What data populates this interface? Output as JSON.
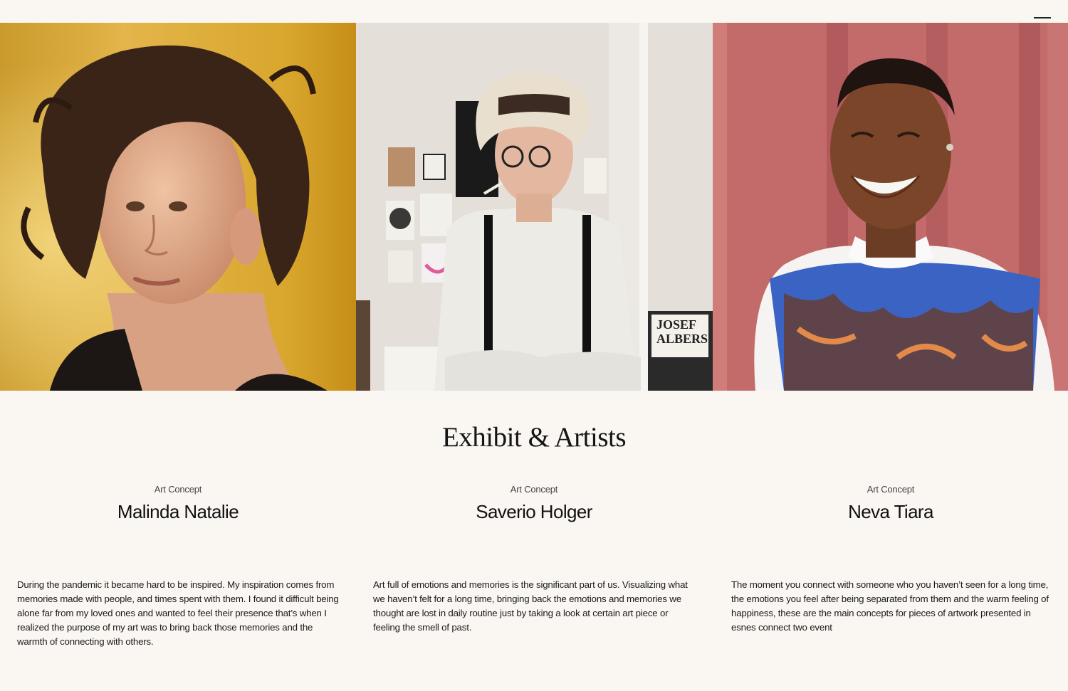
{
  "header": {
    "menu_icon": "hamburger-menu-icon"
  },
  "gallery": {
    "photos": [
      {
        "subject": "portrait-woman-curly-hair",
        "background": "#d9a72e"
      },
      {
        "subject": "portrait-man-hat-glasses",
        "background": "#dedad3"
      },
      {
        "subject": "portrait-woman-smiling",
        "background": "#c36b6b"
      }
    ]
  },
  "section": {
    "title": "Exhibit & Artists"
  },
  "artists": [
    {
      "category": "Art Concept",
      "name": "Malinda Natalie",
      "bio": "During the pandemic it became hard to be inspired. My inspiration comes from memories made with people, and times spent with them. I found it difficult being alone far from my loved ones and wanted to feel their presence that’s when I realized the purpose of my art was to bring back those memories and the warmth of connecting with others."
    },
    {
      "category": "Art Concept",
      "name": "Saverio Holger",
      "bio": "Art full of emotions and memories is the significant part of us. Visualizing what we haven’t felt for a long time, bringing back the emotions and memories we thought are lost in daily routine just by taking a look at certain art piece or feeling the smell of past."
    },
    {
      "category": "Art Concept",
      "name": "Neva Tiara",
      "bio": "The moment you connect with someone who you haven’t seen for a long time, the emotions you feel after being separated from them and the warm feeling of happiness, these are the main concepts for pieces of artwork presented in esnes connect two event"
    }
  ]
}
